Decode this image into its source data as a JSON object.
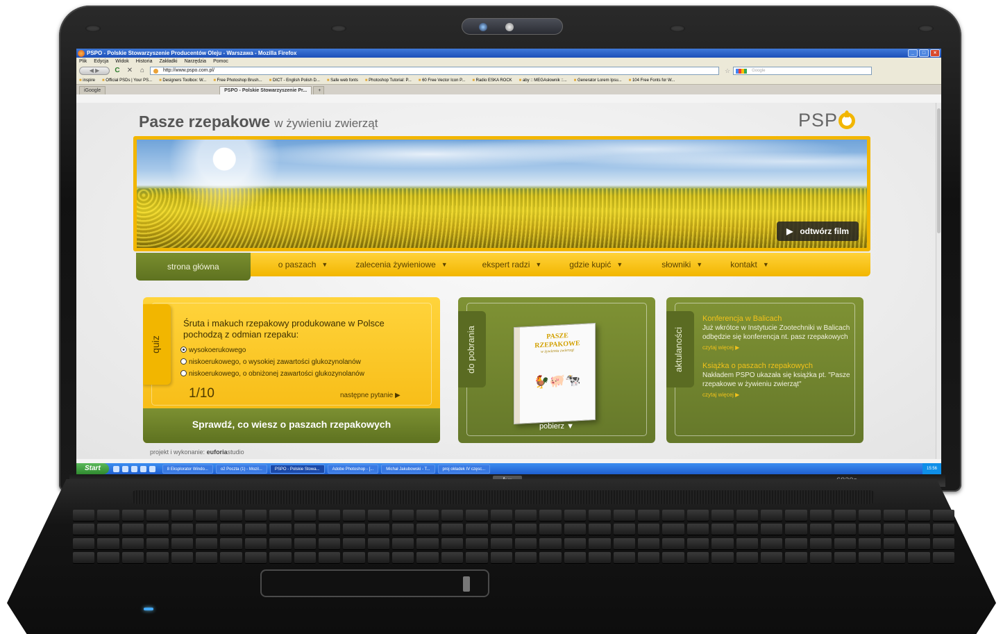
{
  "laptop": {
    "brand": "hp",
    "model": "6830s"
  },
  "browser": {
    "title": "PSPO - Polskie Stowarzyszenie Producentów Oleju - Warszawa - Mozilla Firefox",
    "menu": [
      "Plik",
      "Edycja",
      "Widok",
      "Historia",
      "Zakładki",
      "Narzędzia",
      "Pomoc"
    ],
    "url": "http://www.pspo.com.pl/",
    "search_placeholder": "Google",
    "bookmarks": [
      "inspire",
      "Official PSDs | Your PS...",
      "Designers Toolbox: W...",
      "Free Photoshop Brush...",
      "DICT - English Polish D...",
      "Safe web fonts",
      "Photoshop Tutorial: P...",
      "60 Free Vector Icon P...",
      "Radio ESKA ROCK",
      "aby :: MEGAsłownik ::...",
      "Generator Lorem Ipsu...",
      "104 Free Fonts for W..."
    ],
    "tabs": [
      {
        "label": "iGoogle"
      },
      {
        "label": "PSPO - Polskie Stowarzyszenie Pr..."
      }
    ]
  },
  "site": {
    "title": "Pasze rzepakowe",
    "subtitle": "w żywieniu zwierząt",
    "logo_text": "PSP",
    "play_label": "odtwórz film",
    "nav": [
      {
        "label": "strona główna",
        "dropdown": false
      },
      {
        "label": "o paszach",
        "dropdown": true
      },
      {
        "label": "zalecenia żywieniowe",
        "dropdown": true
      },
      {
        "label": "ekspert radzi",
        "dropdown": true
      },
      {
        "label": "gdzie kupić",
        "dropdown": true
      },
      {
        "label": "słowniki",
        "dropdown": true
      },
      {
        "label": "kontakt",
        "dropdown": true
      }
    ],
    "quiz": {
      "tab": "quiz",
      "question": "Śruta i makuch rzepakowy produkowane w Polsce pochodzą z odmian rzepaku:",
      "options": [
        {
          "label": "wysokoerukowego",
          "checked": true
        },
        {
          "label": "niskoerukowego, o wysokiej zawartości glukozynolanów",
          "checked": false
        },
        {
          "label": "niskoerukowego, o obniżonej zawartości glukozynolanów",
          "checked": false
        }
      ],
      "counter": "1/10",
      "next_label": "następne pytanie",
      "footer": "Sprawdź, co wiesz o paszach rzepakowych"
    },
    "download": {
      "tab": "do pobrania",
      "book_title": "PASZE RZEPAKOWE",
      "book_subtitle": "w żywieniu zwierząt",
      "link": "pobierz"
    },
    "news": {
      "tab": "aktulaności",
      "items": [
        {
          "title": "Konferencja w Balicach",
          "text": "Już wkrótce w Instytucie Zootechniki w Balicach odbędzie się konferencja nt. pasz rzepakowych",
          "more": "czytaj więcej"
        },
        {
          "title": "Książka o paszach rzepakowych",
          "text": "Nakładem PSPO ukazała się książka pt. \"Pasze rzepakowe w żywieniu zwierząt\"",
          "more": "czytaj więcej"
        }
      ]
    },
    "credits_prefix": "projekt i wykonanie:",
    "credits_bold": "euforia",
    "credits_suffix": "studio"
  },
  "taskbar": {
    "start": "Start",
    "tasks": [
      "8 Eksplorator Windo...",
      "o2 Poczta (1) - Mozil...",
      "PSPO - Polskie Stowa...",
      "Adobe Photoshop - [...",
      "Michał Jakubowski - T...",
      "proj okładek IV częsc..."
    ],
    "active_index": 2,
    "clock": "15:56"
  }
}
